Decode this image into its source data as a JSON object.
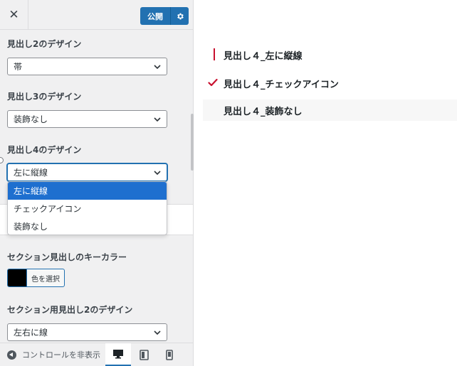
{
  "header": {
    "close_label": "✕",
    "publish_label": "公開"
  },
  "controls": {
    "h2": {
      "label": "見出し2のデザイン",
      "value": "帯"
    },
    "h3": {
      "label": "見出し3のデザイン",
      "value": "装飾なし"
    },
    "h4": {
      "label": "見出し4のデザイン",
      "value": "左に縦線",
      "options": [
        "左に縦線",
        "チェックアイコン",
        "装飾なし"
      ]
    },
    "section_color": {
      "label": "セクション見出しのキーカラー",
      "button_label": "色を選択",
      "color": "#000000"
    },
    "section_h2": {
      "label": "セクション用見出し2のデザイン",
      "value": "左右に線"
    }
  },
  "footer": {
    "collapse_label": "コントロールを非表示"
  },
  "preview": {
    "items": [
      "見出し４_左に縦線",
      "見出し４_チェックアイコン",
      "見出し４_装飾なし"
    ],
    "accent_color": "#c8102e"
  }
}
